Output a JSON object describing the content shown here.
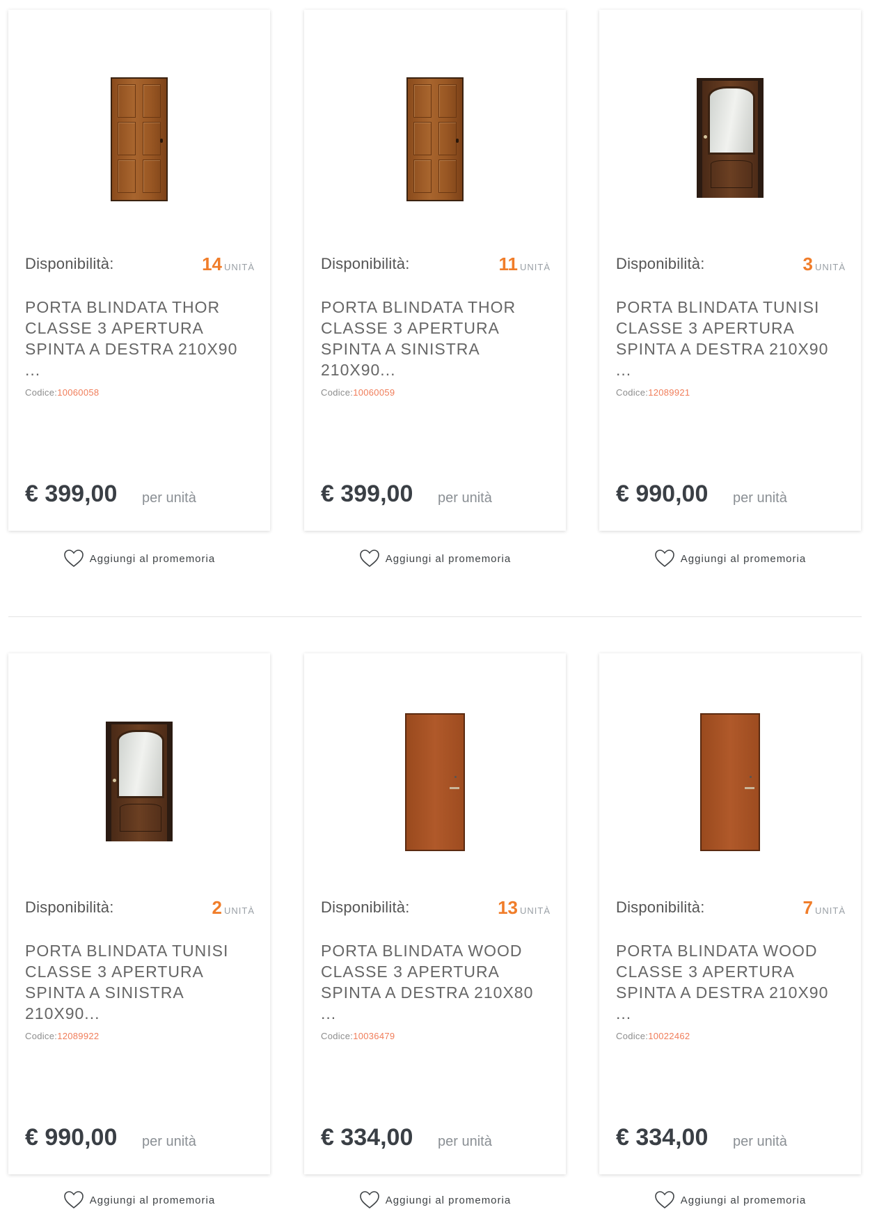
{
  "labels": {
    "availability": "Disponibilità:",
    "unit": "UNITÀ",
    "code": "Codice:",
    "per_unit": "per unità",
    "reminder": "Aggiungi al promemoria"
  },
  "colors": {
    "accent": "#f07d2a",
    "price": "#3a3f45"
  },
  "products": [
    {
      "availability": "14",
      "title": "PORTA BLINDATA THOR CLASSE 3 APERTURA SPINTA A DESTRA 210X90 ...",
      "code": "10060058",
      "price": "€ 399,00",
      "image": "six-panel-wood-door"
    },
    {
      "availability": "11",
      "title": "PORTA BLINDATA THOR CLASSE 3 APERTURA SPINTA A SINISTRA 210X90...",
      "code": "10060059",
      "price": "€ 399,00",
      "image": "six-panel-wood-door"
    },
    {
      "availability": "3",
      "title": "PORTA BLINDATA TUNISI CLASSE 3 APERTURA SPINTA A DESTRA 210X90 ...",
      "code": "12089921",
      "price": "€ 990,00",
      "image": "glass-panel-dark-door"
    },
    {
      "availability": "2",
      "title": "PORTA BLINDATA TUNISI CLASSE 3 APERTURA SPINTA A SINISTRA 210X90...",
      "code": "12089922",
      "price": "€ 990,00",
      "image": "glass-panel-dark-door"
    },
    {
      "availability": "13",
      "title": "PORTA BLINDATA WOOD CLASSE 3 APERTURA SPINTA A DESTRA 210X80 ...",
      "code": "10036479",
      "price": "€ 334,00",
      "image": "flat-wood-door"
    },
    {
      "availability": "7",
      "title": "PORTA BLINDATA WOOD CLASSE 3 APERTURA SPINTA A DESTRA 210X90 ...",
      "code": "10022462",
      "price": "€ 334,00",
      "image": "flat-wood-door"
    }
  ]
}
